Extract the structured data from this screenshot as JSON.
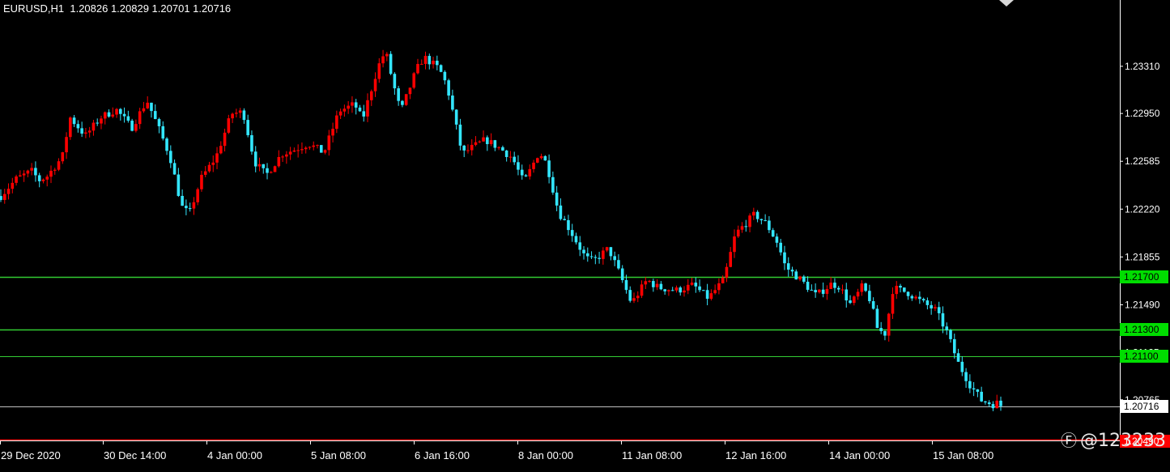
{
  "header": {
    "symbol_text": "EURUSD,H1  1.20826 1.20829 1.20701 1.20716"
  },
  "watermark": {
    "icon": "weibo-like-icon",
    "text": "@123233"
  },
  "colors": {
    "background": "#000000",
    "bull": "#ff0000",
    "bear": "#33e6ff",
    "grid_frame": "#ffffff",
    "level_line": "#33cc33",
    "level_label_bg": "#00dd00",
    "current_price_bg": "#ffffff",
    "red_line": "#ff0000"
  },
  "chart_data": {
    "type": "candlestick",
    "symbol": "EURUSD",
    "timeframe": "H1",
    "ohlc_last": {
      "open": 1.20826,
      "high": 1.20829,
      "low": 1.20701,
      "close": 1.20716
    },
    "y_ticks": [
      "1.23310",
      "1.22950",
      "1.22585",
      "1.22220",
      "1.21855",
      "1.21490",
      "1.21125",
      "1.20765"
    ],
    "y_tick_values": [
      1.2331,
      1.2295,
      1.22585,
      1.2222,
      1.21855,
      1.2149,
      1.21125,
      1.20765
    ],
    "ylim": [
      1.2043,
      1.2368
    ],
    "x_ticks": [
      "29 Dec 2020",
      "30 Dec 14:00",
      "4 Jan 00:00",
      "5 Jan 08:00",
      "6 Jan 16:00",
      "8 Jan 00:00",
      "11 Jan 08:00",
      "12 Jan 16:00",
      "14 Jan 00:00",
      "15 Jan 08:00"
    ],
    "horizontal_levels": [
      {
        "value": 1.217,
        "label": "1.21700"
      },
      {
        "value": 1.213,
        "label": "1.21300"
      },
      {
        "value": 1.211,
        "label": "1.21100"
      }
    ],
    "current_price": {
      "value": 1.20716,
      "label": "1.20716"
    },
    "lower_red_level": {
      "value": 1.2049,
      "label": "1.20490"
    },
    "price_path": [
      [
        0,
        1.2232
      ],
      [
        2,
        1.2245
      ],
      [
        4,
        1.2251
      ],
      [
        5,
        1.2244
      ],
      [
        6,
        1.2247
      ],
      [
        8,
        1.2262
      ],
      [
        9,
        1.2292
      ],
      [
        11,
        1.2278
      ],
      [
        13,
        1.2292
      ],
      [
        15,
        1.2298
      ],
      [
        17,
        1.2284
      ],
      [
        19,
        1.2305
      ],
      [
        20.5,
        1.2284
      ],
      [
        22,
        1.2262
      ],
      [
        23.5,
        1.2224
      ],
      [
        24.5,
        1.2218
      ],
      [
        26,
        1.2245
      ],
      [
        28,
        1.2262
      ],
      [
        30,
        1.2295
      ],
      [
        31.5,
        1.2296
      ],
      [
        33,
        1.2258
      ],
      [
        34.5,
        1.2248
      ],
      [
        36.5,
        1.2264
      ],
      [
        38,
        1.2267
      ],
      [
        40,
        1.2272
      ],
      [
        42,
        1.2265
      ],
      [
        44,
        1.2297
      ],
      [
        46,
        1.2302
      ],
      [
        47,
        1.229
      ],
      [
        49,
        1.233
      ],
      [
        50,
        1.2343
      ],
      [
        51,
        1.2318
      ],
      [
        52,
        1.2296
      ],
      [
        54,
        1.2328
      ],
      [
        55,
        1.2338
      ],
      [
        57,
        1.2329
      ],
      [
        58,
        1.2316
      ],
      [
        60,
        1.2264
      ],
      [
        61,
        1.2268
      ],
      [
        63,
        1.2275
      ],
      [
        65,
        1.2268
      ],
      [
        66.5,
        1.2261
      ],
      [
        68,
        1.2242
      ],
      [
        70,
        1.2266
      ],
      [
        71,
        1.2256
      ],
      [
        72.5,
        1.222
      ],
      [
        74,
        1.2206
      ],
      [
        76,
        1.2185
      ],
      [
        77,
        1.2182
      ],
      [
        79,
        1.2192
      ],
      [
        80.5,
        1.2172
      ],
      [
        82,
        1.215
      ],
      [
        84,
        1.2168
      ],
      [
        85.5,
        1.2162
      ],
      [
        88,
        1.216
      ],
      [
        90,
        1.2164
      ],
      [
        92,
        1.2154
      ],
      [
        94,
        1.2168
      ],
      [
        95.5,
        1.2203
      ],
      [
        97,
        1.2212
      ],
      [
        98,
        1.2218
      ],
      [
        99.5,
        1.2211
      ],
      [
        101,
        1.2196
      ],
      [
        102,
        1.2178
      ],
      [
        104,
        1.2168
      ],
      [
        106,
        1.2156
      ],
      [
        108,
        1.2165
      ],
      [
        109,
        1.2163
      ],
      [
        110.5,
        1.2149
      ],
      [
        112,
        1.2163
      ],
      [
        113,
        1.2153
      ],
      [
        114,
        1.213
      ],
      [
        115,
        1.2127
      ],
      [
        116,
        1.2162
      ],
      [
        118,
        1.2158
      ],
      [
        120,
        1.215
      ],
      [
        121.5,
        1.2145
      ],
      [
        123,
        1.2128
      ],
      [
        124.5,
        1.2104
      ],
      [
        126,
        1.2088
      ],
      [
        127.5,
        1.2076
      ],
      [
        129,
        1.2073
      ],
      [
        130,
        1.2075
      ]
    ]
  }
}
